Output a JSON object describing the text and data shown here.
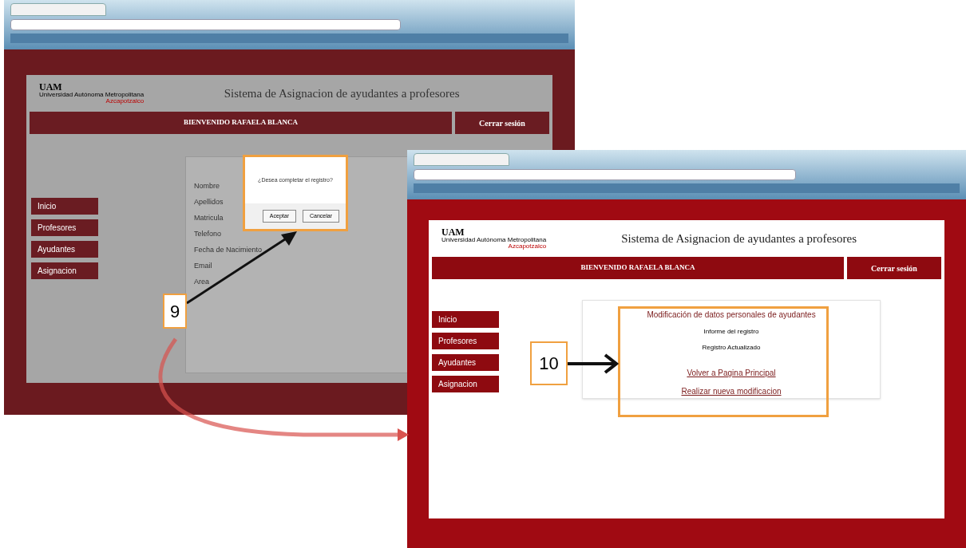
{
  "back_window": {
    "logo": {
      "mark": "UAM",
      "name": "Universidad Autónoma Metropolitana",
      "campus": "Azcapotzalco"
    },
    "title": "Sistema de Asignacion de ayudantes a profesores",
    "welcome": "BIENVENIDO RAFAELA BLANCA",
    "logout": "Cerrar sesión",
    "nav": [
      {
        "label": "Inicio"
      },
      {
        "label": "Profesores"
      },
      {
        "label": "Ayudantes"
      },
      {
        "label": "Asignacion"
      }
    ],
    "form_labels": [
      "Nombre",
      "Apellidos",
      "Matricula",
      "Telefono",
      "Fecha de Nacimiento",
      "Email",
      "Area"
    ],
    "dialog": {
      "message": "¿Desea completar el registro?",
      "buttons": [
        "Aceptar",
        "Cancelar"
      ]
    }
  },
  "front_window": {
    "logo": {
      "mark": "UAM",
      "name": "Universidad Autónoma Metropolitana",
      "campus": "Azcapotzalco"
    },
    "title": "Sistema de Asignacion de ayudantes a profesores",
    "welcome": "BIENVENIDO RAFAELA BLANCA",
    "logout": "Cerrar sesión",
    "nav": [
      {
        "label": "Inicio"
      },
      {
        "label": "Profesores"
      },
      {
        "label": "Ayudantes"
      },
      {
        "label": "Asignacion"
      }
    ],
    "result": {
      "heading": "Modificación de datos personales de ayudantes",
      "subheading": "Informe del registro",
      "status": "Registro Actualizado",
      "links": [
        "Volver a Pagina Principal",
        "Realizar nueva modificacion"
      ]
    }
  },
  "annotations": [
    {
      "label": "9"
    },
    {
      "label": "10"
    }
  ]
}
